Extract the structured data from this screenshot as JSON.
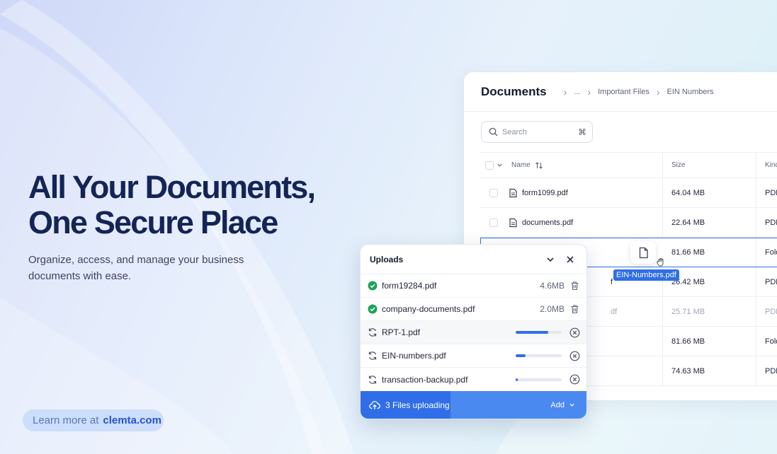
{
  "hero": {
    "title_line1": "All Your Documents,",
    "title_line2": "One Secure Place",
    "subtitle": "Organize, access, and manage your business documents with ease.",
    "learn_label": "Learn more at",
    "learn_link": "clemta.com"
  },
  "documents": {
    "title": "Documents",
    "breadcrumb": [
      "...",
      "Important Files",
      "EIN Numbers"
    ],
    "search_placeholder": "Search",
    "search_shortcut": "⌘",
    "columns": {
      "name": "Name",
      "size": "Size",
      "kind": "Kind"
    },
    "rows": [
      {
        "name": "form1099.pdf",
        "size": "64.04 MB",
        "kind": "PDF"
      },
      {
        "name": "documents.pdf",
        "size": "22.64 MB",
        "kind": "PDF"
      },
      {
        "name": "",
        "size": "81.66 MB",
        "kind": "Fold"
      },
      {
        "name": "f",
        "size": "26.42 MB",
        "kind": "PDF"
      },
      {
        "name": "df",
        "size": "25.71 MB",
        "kind": "PDF"
      },
      {
        "name": "",
        "size": "81.66 MB",
        "kind": "Fold"
      },
      {
        "name": "",
        "size": "74.63 MB",
        "kind": "PDF"
      }
    ],
    "drag_file": "EIN-Numbers.pdf"
  },
  "uploads": {
    "title": "Uploads",
    "items": [
      {
        "name": "form19284.pdf",
        "size": "4.6MB"
      },
      {
        "name": "company-documents.pdf",
        "size": "2.0MB"
      },
      {
        "name": "RPT-1.pdf",
        "progress": 0.7
      },
      {
        "name": "EIN-numbers.pdf",
        "progress": 0.22
      },
      {
        "name": "transaction-backup.pdf",
        "progress": 0.05
      }
    ],
    "status": "3 Files uploading",
    "add_label": "Add"
  },
  "colors": {
    "accent": "#2f6ee6",
    "success": "#1ea35a",
    "title": "#142457"
  }
}
